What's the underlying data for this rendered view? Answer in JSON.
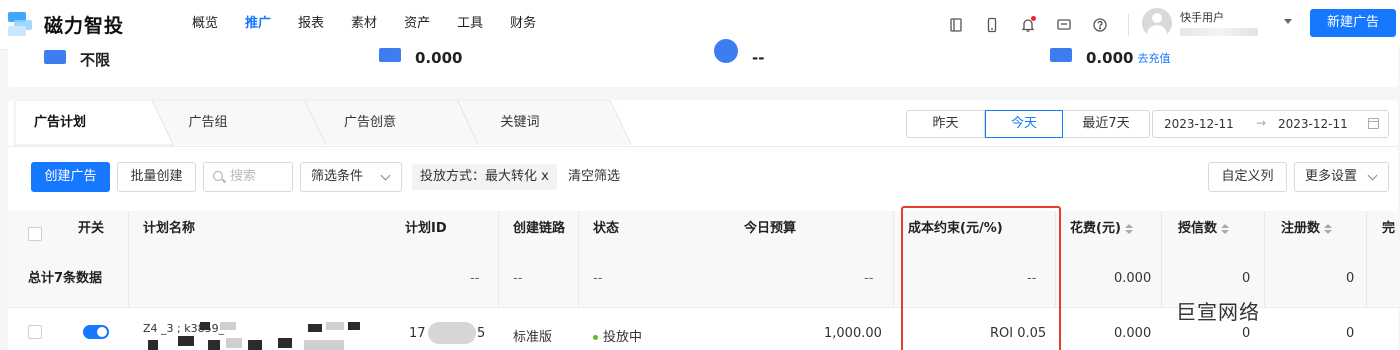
{
  "app": {
    "logo_text": "磁力智投"
  },
  "nav": {
    "links": [
      "概览",
      "推广",
      "报表",
      "素材",
      "资产",
      "工具",
      "财务"
    ],
    "active_index": 1,
    "icons": [
      "tablet-icon",
      "phone-icon",
      "bell-icon",
      "message-icon",
      "help-icon"
    ],
    "user_name": "快手用户",
    "new_ad_button": "新建广告"
  },
  "summary": {
    "items": [
      {
        "value": "不限"
      },
      {
        "value": "0.000"
      },
      {
        "value": "--"
      },
      {
        "value": "0.000",
        "link": "去充值"
      }
    ]
  },
  "tabs": [
    "广告计划",
    "广告组",
    "广告创意",
    "关键词"
  ],
  "date_range": {
    "options": [
      "昨天",
      "今天",
      "最近7天"
    ],
    "active_index": 1,
    "start": "2023-12-11",
    "arrow": "→",
    "end": "2023-12-11"
  },
  "toolbar": {
    "create_ad": "创建广告",
    "batch_create": "批量创建",
    "search_placeholder": "搜索",
    "filter_label": "筛选条件",
    "filter_tag": "投放方式：最大转化 x",
    "clear_filter": "清空筛选",
    "custom_columns": "自定义列",
    "more_settings": "更多设置"
  },
  "table": {
    "headers": {
      "switch": "开关",
      "name": "计划名称",
      "id": "计划ID",
      "link": "创建链路",
      "status": "状态",
      "budget": "今日预算",
      "cost_constraint": "成本约束(元/%)",
      "spend": "花费(元)",
      "credit": "授信数",
      "register": "注册数",
      "complete": "完"
    },
    "total": {
      "label": "总计7条数据",
      "id": "--",
      "link": "--",
      "status": "--",
      "budget": "--",
      "cost_constraint": "--",
      "spend": "0.000",
      "credit": "0",
      "register": "0"
    },
    "rows": [
      {
        "name_visible": "Z4 _3 ; k3859_",
        "id_prefix": "17",
        "id_suffix": "5",
        "link": "标准版",
        "status": "投放中",
        "budget": "1,000.00",
        "cost_constraint": "ROI 0.05",
        "spend": "0.000",
        "credit": "0",
        "register": "0"
      }
    ]
  },
  "watermark": "巨宣网络",
  "colors": {
    "accent": "#1677ff",
    "highlight_box": "#e53d32",
    "status_running": "#52c41a"
  }
}
